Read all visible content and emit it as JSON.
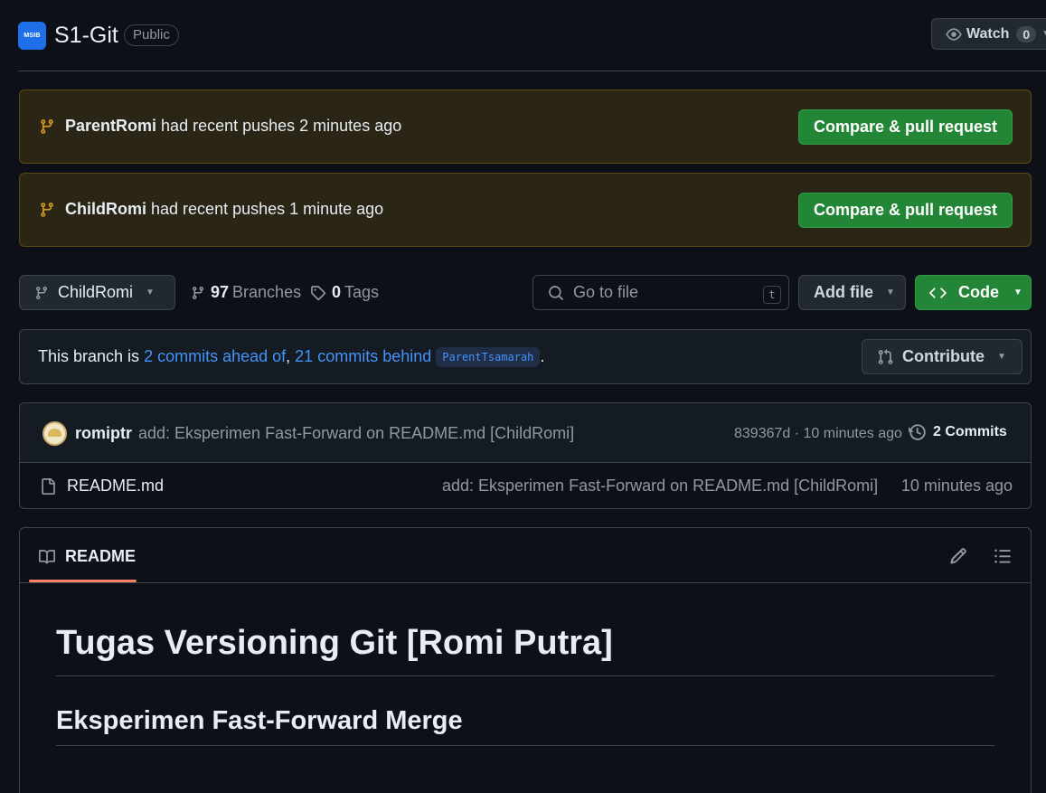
{
  "header": {
    "logo_text": "MSIB",
    "repo_name": "S1-Git",
    "visibility": "Public",
    "watch_label": "Watch",
    "watch_count": "0"
  },
  "banners": [
    {
      "branch": "ParentRomi",
      "message": "had recent pushes 2 minutes ago",
      "button": "Compare & pull request"
    },
    {
      "branch": "ChildRomi",
      "message": "had recent pushes 1 minute ago",
      "button": "Compare & pull request"
    }
  ],
  "toolbar": {
    "current_branch": "ChildRomi",
    "branches_count": "97",
    "branches_label": "Branches",
    "tags_count": "0",
    "tags_label": "Tags",
    "search_placeholder": "Go to file",
    "search_shortcut": "t",
    "add_file_label": "Add file",
    "code_label": "Code"
  },
  "ahead": {
    "prefix": "This branch is",
    "ahead_link": "2 commits ahead of",
    "separator": ",",
    "behind_link": "21 commits behind",
    "base_branch": "ParentTsamarah",
    "suffix": ".",
    "contribute_label": "Contribute"
  },
  "latest_commit": {
    "author": "romiptr",
    "message": "add: Eksperimen Fast-Forward on README.md [ChildRomi]",
    "sha_time": "839367d · 10 minutes ago",
    "commits_label": "2 Commits"
  },
  "files": [
    {
      "name": "README.md",
      "message": "add: Eksperimen Fast-Forward on README.md [ChildRomi]",
      "time": "10 minutes ago"
    }
  ],
  "readme": {
    "tab_label": "README",
    "h1": "Tugas Versioning Git [Romi Putra]",
    "h2": "Eksperimen Fast-Forward Merge"
  },
  "colors": {
    "accent_green": "#238636",
    "link_blue": "#4493f8",
    "banner_bg": "#2b2516",
    "tab_underline": "#f78166"
  }
}
